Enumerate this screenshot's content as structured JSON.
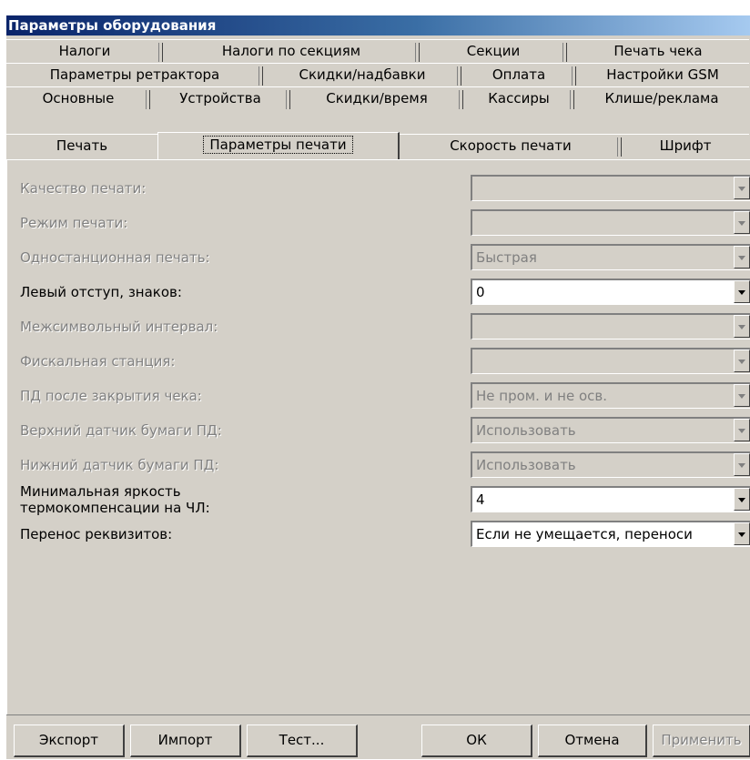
{
  "window": {
    "title": "Параметры оборудования"
  },
  "tabs": {
    "row1": [
      "Налоги",
      "Налоги по секциям",
      "Секции",
      "Печать чека"
    ],
    "row2": [
      "Параметры ретрактора",
      "Скидки/надбавки",
      "Оплата",
      "Настройки GSM"
    ],
    "row3": [
      "Основные",
      "Устройства",
      "Скидки/время",
      "Кассиры",
      "Клише/реклама"
    ],
    "row4": [
      "Печать",
      "Параметры печати",
      "Скорость печати",
      "Шрифт"
    ],
    "active": "Параметры печати"
  },
  "fields": [
    {
      "label": "Качество печати:",
      "value": "",
      "enabled": false
    },
    {
      "label": "Режим печати:",
      "value": "",
      "enabled": false
    },
    {
      "label": "Одностанционная печать:",
      "value": "Быстрая",
      "enabled": false
    },
    {
      "label": "Левый отступ, знаков:",
      "value": "0",
      "enabled": true
    },
    {
      "label": "Межсимвольный интервал:",
      "value": "",
      "enabled": false
    },
    {
      "label": "Фискальная станция:",
      "value": "",
      "enabled": false
    },
    {
      "label": "ПД после закрытия чека:",
      "value": "Не пром. и не осв.",
      "enabled": false
    },
    {
      "label": "Верхний датчик бумаги ПД:",
      "value": "Использовать",
      "enabled": false
    },
    {
      "label": "Нижний датчик бумаги ПД:",
      "value": "Использовать",
      "enabled": false
    },
    {
      "label": "Минимальная яркость",
      "label2": "термокомпенсации на ЧЛ:",
      "value": "4",
      "enabled": true
    },
    {
      "label": "Перенос реквизитов:",
      "value": "Если не умещается, переноси",
      "enabled": true
    }
  ],
  "buttons": {
    "export": "Экспорт",
    "import": "Импорт",
    "test": "Тест...",
    "ok": "ОК",
    "cancel": "Отмена",
    "apply": "Применить"
  }
}
